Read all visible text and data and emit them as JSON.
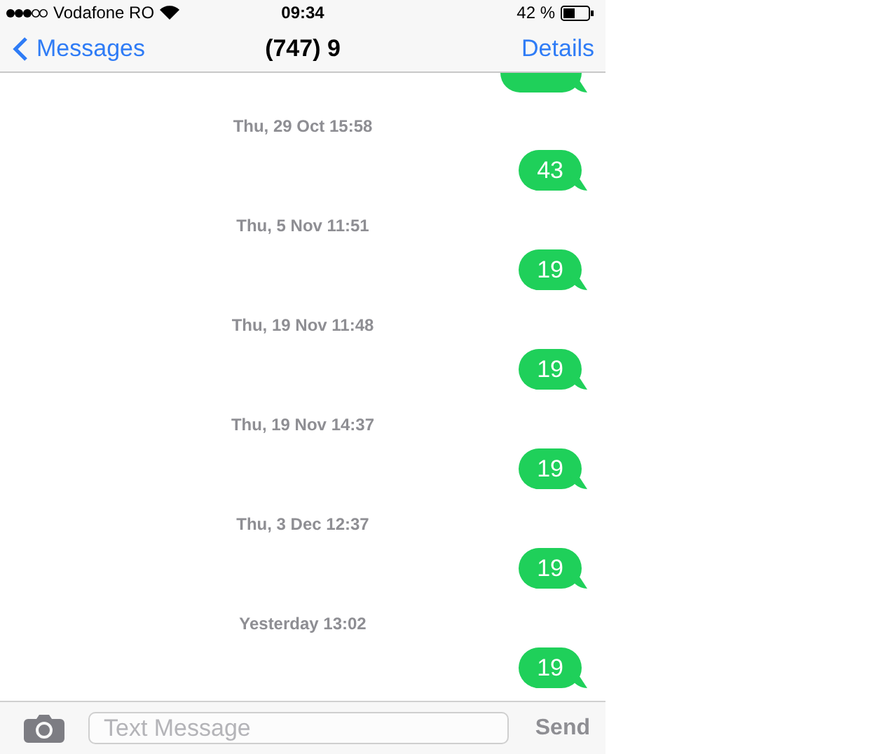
{
  "status_bar": {
    "carrier": "Vodafone RO",
    "time": "09:34",
    "battery": "42 %"
  },
  "nav_bar": {
    "back": "Messages",
    "title": "(747) 9",
    "action": "Details"
  },
  "messages": [
    {
      "kind": "bubble_cut"
    },
    {
      "kind": "timestamp",
      "text": "Thu, 29 Oct 15:58"
    },
    {
      "kind": "bubble",
      "text": "43"
    },
    {
      "kind": "timestamp",
      "text": "Thu, 5 Nov 11:51"
    },
    {
      "kind": "bubble",
      "text": "19"
    },
    {
      "kind": "timestamp",
      "text": "Thu, 19 Nov 11:48"
    },
    {
      "kind": "bubble",
      "text": "19"
    },
    {
      "kind": "timestamp",
      "text": "Thu, 19 Nov 14:37"
    },
    {
      "kind": "bubble",
      "text": "19"
    },
    {
      "kind": "timestamp",
      "text": "Thu, 3 Dec 12:37"
    },
    {
      "kind": "bubble",
      "text": "19"
    },
    {
      "kind": "timestamp",
      "text": "Yesterday 13:02"
    },
    {
      "kind": "bubble",
      "text": "19"
    }
  ],
  "input_bar": {
    "placeholder": "Text Message",
    "send": "Send",
    "send_disabled": true
  }
}
